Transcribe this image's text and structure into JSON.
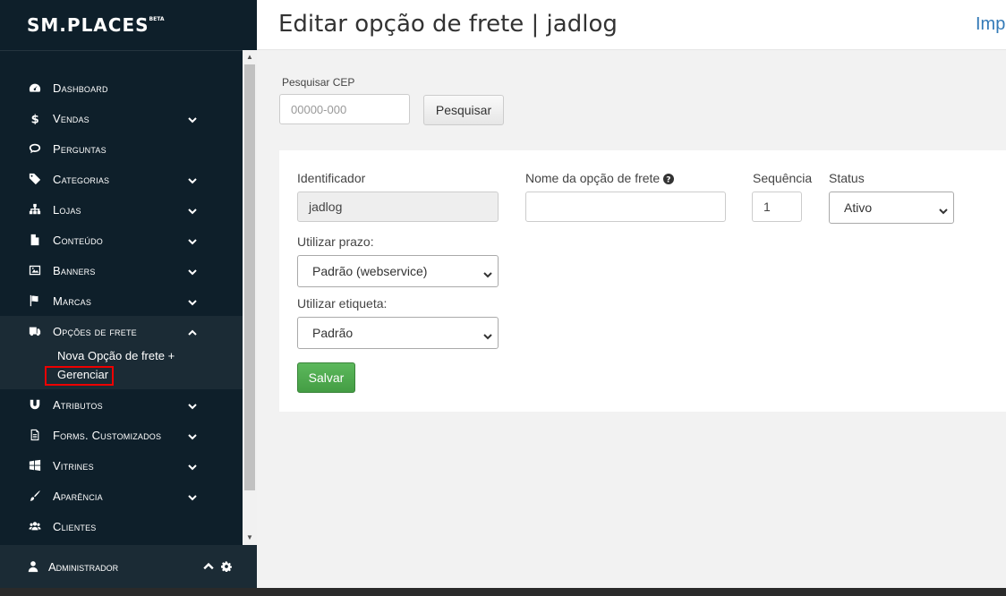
{
  "brand": {
    "logo": "SM.PLACES",
    "badge": "BETA"
  },
  "sidebar": {
    "items": [
      {
        "label": "Dashboard",
        "icon": "dashboard-icon"
      },
      {
        "label": "Vendas",
        "icon": "dollar-icon",
        "expandable": true
      },
      {
        "label": "Perguntas",
        "icon": "comments-icon"
      },
      {
        "label": "Categorias",
        "icon": "tags-icon",
        "expandable": true
      },
      {
        "label": "Lojas",
        "icon": "sitemap-icon",
        "expandable": true
      },
      {
        "label": "Conteúdo",
        "icon": "file-icon",
        "expandable": true
      },
      {
        "label": "Banners",
        "icon": "image-icon",
        "expandable": true
      },
      {
        "label": "Marcas",
        "icon": "flag-icon",
        "expandable": true
      },
      {
        "label": "Opções de frete",
        "icon": "truck-icon",
        "expandable": true,
        "expanded": true
      },
      {
        "label": "Atributos",
        "icon": "magnet-icon",
        "expandable": true
      },
      {
        "label": "Forms. Customizados",
        "icon": "form-icon",
        "expandable": true
      },
      {
        "label": "Vitrines",
        "icon": "windows-icon",
        "expandable": true
      },
      {
        "label": "Aparência",
        "icon": "brush-icon",
        "expandable": true
      },
      {
        "label": "Clientes",
        "icon": "users-icon"
      }
    ],
    "submenu": {
      "new_label": "Nova Opção de frete +",
      "manage_label": "Gerenciar"
    },
    "admin": {
      "label": "Administrador"
    }
  },
  "header": {
    "title": "Editar opção de frete | jadlog",
    "link": "Imp"
  },
  "search": {
    "label": "Pesquisar CEP",
    "placeholder": "00000-000",
    "button": "Pesquisar"
  },
  "form": {
    "identifier": {
      "label": "Identificador",
      "value": "jadlog"
    },
    "name": {
      "label": "Nome da opção de frete",
      "value": ""
    },
    "sequence": {
      "label": "Sequência",
      "value": "1"
    },
    "status": {
      "label": "Status",
      "value": "Ativo"
    },
    "prazo": {
      "label": "Utilizar prazo:",
      "value": "Padrão (webservice)"
    },
    "etiqueta": {
      "label": "Utilizar etiqueta:",
      "value": "Padrão"
    },
    "save": "Salvar"
  },
  "colors": {
    "sidebar_bg": "#0e1f2a",
    "accent_link": "#337ab7",
    "save_green": "#5cb85c",
    "highlight_red": "#e00000"
  }
}
